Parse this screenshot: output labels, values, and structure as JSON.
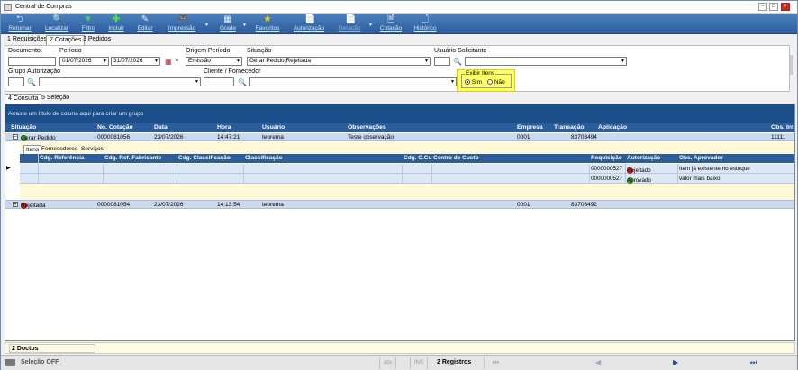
{
  "window": {
    "title": "Central de Compras"
  },
  "toolbar": {
    "buttons": [
      {
        "label": "Retornar",
        "icon": "return-arrow-icon"
      },
      {
        "label": "Localizar",
        "icon": "search-icon"
      },
      {
        "label": "Filtro",
        "icon": "filter-funnel-icon"
      },
      {
        "label": "Incluir",
        "icon": "plus-icon"
      },
      {
        "label": "Editar",
        "icon": "edit-icon"
      },
      {
        "label": "Impressão",
        "icon": "gamepad-icon"
      },
      {
        "label": "Grade",
        "icon": "grid-icon"
      },
      {
        "label": "Favoritos",
        "icon": "star-icon"
      },
      {
        "label": "Autorização",
        "icon": "document-check-icon"
      },
      {
        "label": "Geração",
        "icon": "document-gen-icon"
      },
      {
        "label": "Cotação",
        "icon": "quote-icon"
      },
      {
        "label": "Histórico",
        "icon": "history-icon"
      }
    ]
  },
  "main_tabs": [
    "1 Requisições",
    "2 Cotações",
    "3 Pedidos"
  ],
  "filters": {
    "documento_label": "Documento",
    "periodo_label": "Período",
    "data_inicio": "01/07/2026",
    "data_fim": "31/07/2026",
    "origem_label": "Origem Período",
    "origem_value": "Emissão",
    "situacao_label": "Situação",
    "situacao_value": "Gerar Pedido;Rejeitada",
    "usuario_label": "Usuário Solicitante",
    "grupo_label": "Grupo Autorização",
    "cliente_label": "Cliente / Fornecedor",
    "exibe_title": "Exibir Itens",
    "exibe_sim": "Sim",
    "exibe_nao": "Não"
  },
  "sub_tabs": [
    "4 Consulta",
    "5 Seleção"
  ],
  "grid": {
    "group_hint": "Arraste um título de coluna aqui para criar um grupo",
    "columns": [
      "Situação",
      "No. Cotação",
      "Data",
      "Hora",
      "Usuário",
      "Observações",
      "Empresa",
      "Transação",
      "Aplicação",
      "Obs. Int"
    ],
    "rows": [
      {
        "situacao": "Gerar Pedido",
        "status_color": "#3daa2a",
        "cotacao": "0000081056",
        "data": "23/07/2026",
        "hora": "14:47:21",
        "usuario": "teorema",
        "observacoes": "Teste observação",
        "empresa": "0001",
        "transacao": "83703494",
        "aplicacao": "",
        "obs_int": "11111"
      },
      {
        "situacao": "Rejeitada",
        "status_color": "#d42020",
        "cotacao": "0000081054",
        "data": "23/07/2026",
        "hora": "14:13:54",
        "usuario": "teorema",
        "observacoes": "",
        "empresa": "0001",
        "transacao": "83703492",
        "aplicacao": "",
        "obs_int": ""
      }
    ],
    "detail": {
      "tabs": [
        "Itens",
        "Fornecedores",
        "Serviços"
      ],
      "columns": [
        "Cdg. Referência",
        "Cdg. Ref. Fabricante",
        "Cdg. Classificação",
        "Classificação",
        "Cdg. C.Cu",
        "Centro de Custo",
        "Requisição",
        "Autorização",
        "Obs. Aprovador"
      ],
      "rows": [
        {
          "requisicao": "0000000527",
          "autorizacao": "Rejeitado",
          "status_color": "#d42020",
          "obs": "Item já existente no estoque"
        },
        {
          "requisicao": "0000000527",
          "autorizacao": "Aprovado",
          "status_color": "#3daa2a",
          "obs": "valor mais baixo"
        }
      ]
    }
  },
  "footer": {
    "count": "2 Doctos"
  },
  "statusbar": {
    "selecao": "Seleção OFF",
    "abc": "abc",
    "ins": "INS",
    "registros": "2 Registros"
  }
}
